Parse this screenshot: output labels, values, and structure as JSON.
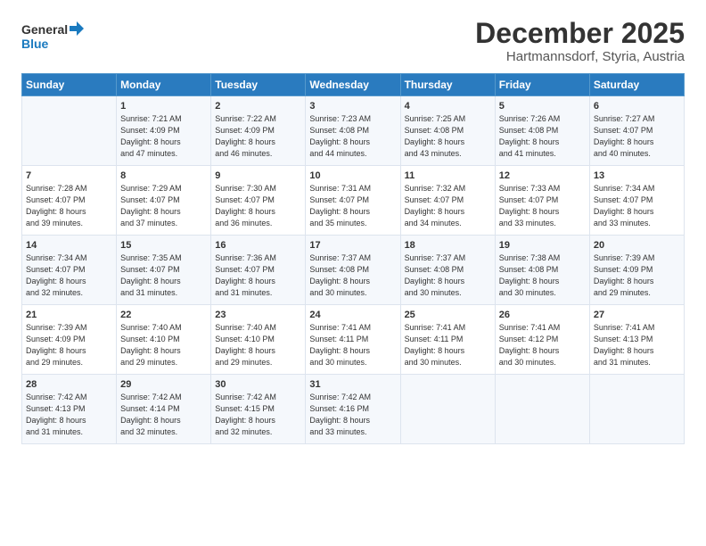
{
  "header": {
    "logo_general": "General",
    "logo_blue": "Blue",
    "month": "December 2025",
    "location": "Hartmannsdorf, Styria, Austria"
  },
  "days_of_week": [
    "Sunday",
    "Monday",
    "Tuesday",
    "Wednesday",
    "Thursday",
    "Friday",
    "Saturday"
  ],
  "weeks": [
    [
      {
        "day": "",
        "info": ""
      },
      {
        "day": "1",
        "info": "Sunrise: 7:21 AM\nSunset: 4:09 PM\nDaylight: 8 hours\nand 47 minutes."
      },
      {
        "day": "2",
        "info": "Sunrise: 7:22 AM\nSunset: 4:09 PM\nDaylight: 8 hours\nand 46 minutes."
      },
      {
        "day": "3",
        "info": "Sunrise: 7:23 AM\nSunset: 4:08 PM\nDaylight: 8 hours\nand 44 minutes."
      },
      {
        "day": "4",
        "info": "Sunrise: 7:25 AM\nSunset: 4:08 PM\nDaylight: 8 hours\nand 43 minutes."
      },
      {
        "day": "5",
        "info": "Sunrise: 7:26 AM\nSunset: 4:08 PM\nDaylight: 8 hours\nand 41 minutes."
      },
      {
        "day": "6",
        "info": "Sunrise: 7:27 AM\nSunset: 4:07 PM\nDaylight: 8 hours\nand 40 minutes."
      }
    ],
    [
      {
        "day": "7",
        "info": "Sunrise: 7:28 AM\nSunset: 4:07 PM\nDaylight: 8 hours\nand 39 minutes."
      },
      {
        "day": "8",
        "info": "Sunrise: 7:29 AM\nSunset: 4:07 PM\nDaylight: 8 hours\nand 37 minutes."
      },
      {
        "day": "9",
        "info": "Sunrise: 7:30 AM\nSunset: 4:07 PM\nDaylight: 8 hours\nand 36 minutes."
      },
      {
        "day": "10",
        "info": "Sunrise: 7:31 AM\nSunset: 4:07 PM\nDaylight: 8 hours\nand 35 minutes."
      },
      {
        "day": "11",
        "info": "Sunrise: 7:32 AM\nSunset: 4:07 PM\nDaylight: 8 hours\nand 34 minutes."
      },
      {
        "day": "12",
        "info": "Sunrise: 7:33 AM\nSunset: 4:07 PM\nDaylight: 8 hours\nand 33 minutes."
      },
      {
        "day": "13",
        "info": "Sunrise: 7:34 AM\nSunset: 4:07 PM\nDaylight: 8 hours\nand 33 minutes."
      }
    ],
    [
      {
        "day": "14",
        "info": "Sunrise: 7:34 AM\nSunset: 4:07 PM\nDaylight: 8 hours\nand 32 minutes."
      },
      {
        "day": "15",
        "info": "Sunrise: 7:35 AM\nSunset: 4:07 PM\nDaylight: 8 hours\nand 31 minutes."
      },
      {
        "day": "16",
        "info": "Sunrise: 7:36 AM\nSunset: 4:07 PM\nDaylight: 8 hours\nand 31 minutes."
      },
      {
        "day": "17",
        "info": "Sunrise: 7:37 AM\nSunset: 4:08 PM\nDaylight: 8 hours\nand 30 minutes."
      },
      {
        "day": "18",
        "info": "Sunrise: 7:37 AM\nSunset: 4:08 PM\nDaylight: 8 hours\nand 30 minutes."
      },
      {
        "day": "19",
        "info": "Sunrise: 7:38 AM\nSunset: 4:08 PM\nDaylight: 8 hours\nand 30 minutes."
      },
      {
        "day": "20",
        "info": "Sunrise: 7:39 AM\nSunset: 4:09 PM\nDaylight: 8 hours\nand 29 minutes."
      }
    ],
    [
      {
        "day": "21",
        "info": "Sunrise: 7:39 AM\nSunset: 4:09 PM\nDaylight: 8 hours\nand 29 minutes."
      },
      {
        "day": "22",
        "info": "Sunrise: 7:40 AM\nSunset: 4:10 PM\nDaylight: 8 hours\nand 29 minutes."
      },
      {
        "day": "23",
        "info": "Sunrise: 7:40 AM\nSunset: 4:10 PM\nDaylight: 8 hours\nand 29 minutes."
      },
      {
        "day": "24",
        "info": "Sunrise: 7:41 AM\nSunset: 4:11 PM\nDaylight: 8 hours\nand 30 minutes."
      },
      {
        "day": "25",
        "info": "Sunrise: 7:41 AM\nSunset: 4:11 PM\nDaylight: 8 hours\nand 30 minutes."
      },
      {
        "day": "26",
        "info": "Sunrise: 7:41 AM\nSunset: 4:12 PM\nDaylight: 8 hours\nand 30 minutes."
      },
      {
        "day": "27",
        "info": "Sunrise: 7:41 AM\nSunset: 4:13 PM\nDaylight: 8 hours\nand 31 minutes."
      }
    ],
    [
      {
        "day": "28",
        "info": "Sunrise: 7:42 AM\nSunset: 4:13 PM\nDaylight: 8 hours\nand 31 minutes."
      },
      {
        "day": "29",
        "info": "Sunrise: 7:42 AM\nSunset: 4:14 PM\nDaylight: 8 hours\nand 32 minutes."
      },
      {
        "day": "30",
        "info": "Sunrise: 7:42 AM\nSunset: 4:15 PM\nDaylight: 8 hours\nand 32 minutes."
      },
      {
        "day": "31",
        "info": "Sunrise: 7:42 AM\nSunset: 4:16 PM\nDaylight: 8 hours\nand 33 minutes."
      },
      {
        "day": "",
        "info": ""
      },
      {
        "day": "",
        "info": ""
      },
      {
        "day": "",
        "info": ""
      }
    ]
  ]
}
